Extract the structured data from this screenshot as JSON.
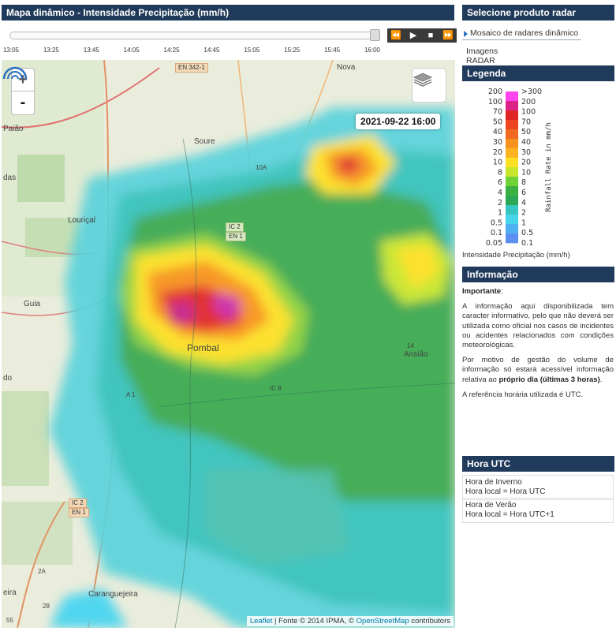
{
  "map_panel": {
    "title": "Mapa dinâmico - Intensidade Precipitação (mm/h)",
    "time_ticks": [
      "13:05",
      "13:25",
      "13:45",
      "14:05",
      "14:25",
      "14:45",
      "15:05",
      "15:25",
      "15:45",
      "16:00"
    ],
    "slider_fraction": 1.0,
    "controls": {
      "rewind": "⏪",
      "play": "▶",
      "stop": "■",
      "forward": "⏩"
    },
    "zoom_in": "+",
    "zoom_out": "-",
    "timestamp": "2021-09-22 16:00",
    "attribution": {
      "leaflet": "Leaflet",
      "source": " | Fonte © 2014 IPMA, © ",
      "osm": "OpenStreetMap",
      "contributors": " contributors"
    },
    "places": {
      "nova": "Nova",
      "paiao": "Paião",
      "soure": "Soure",
      "das": "das",
      "lourical": "Louriçal",
      "guia": "Guia",
      "pombal": "Pombal",
      "ansiao": "Ansião",
      "do": "do",
      "eira": "eira",
      "caranguejeira": "Caranguejeira"
    },
    "roads": {
      "en3421": "EN 342-1",
      "ic2a": "IC 2",
      "en1a": "EN 1",
      "ic2b": "IC 2",
      "en1b": "EN 1",
      "ic8": "IC 8",
      "a1": "A 1",
      "r10a": "10A",
      "r14": "14",
      "r2a": "2A",
      "r28": "28",
      "r55": "55"
    }
  },
  "radar_panel": {
    "title": "Selecione produto radar",
    "links": [
      "Mosaico de radares dinâmico",
      "Imagens RADAR"
    ]
  },
  "legend_panel": {
    "title": "Legenda",
    "left_labels": [
      "200",
      "100",
      "70",
      "50",
      "40",
      "30",
      "20",
      "10",
      "8",
      "6",
      "4",
      "2",
      "1",
      "0.5",
      "0.1",
      "0.05"
    ],
    "right_labels": [
      ">300",
      "200",
      "100",
      "70",
      "50",
      "40",
      "30",
      "20",
      "10",
      "8",
      "6",
      "4",
      "2",
      "1",
      "0.5",
      "0.1"
    ],
    "axis_label": "Rainfall Rate in mm/h",
    "caption": "Intensidade Precipitação (mm/h)",
    "colors": [
      "#ff44ee",
      "#dd2288",
      "#e02525",
      "#ee4422",
      "#f06a20",
      "#f7921e",
      "#fbb320",
      "#fde023",
      "#c8e62a",
      "#6fd236",
      "#3cb043",
      "#2aa854",
      "#38c6c0",
      "#45d4e8",
      "#4fb0f0",
      "#5b8ff0"
    ]
  },
  "info_panel": {
    "title": "Informação",
    "important": "Importante",
    "important_colon": ":",
    "p1": "A informação aqui disponibilizada tem caracter informativo, pelo que não deverá ser utilizada como oficial nos casos de incidentes ou acidentes relacionados com condições meteorológicas.",
    "p2_start": "Por motivo de gestão do volume de informação só estará acessível informação relativa ao ",
    "p2_bold": "próprio dia (últimas 3 horas)",
    "p2_end": ".",
    "p3": "A referência horária utilizada é UTC."
  },
  "utc_panel": {
    "title": "Hora UTC",
    "winter_title": "Hora de Inverno",
    "winter_value": "Hora local = Hora UTC",
    "summer_title": "Hora de Verão",
    "summer_value": "Hora local = Hora UTC+1"
  }
}
